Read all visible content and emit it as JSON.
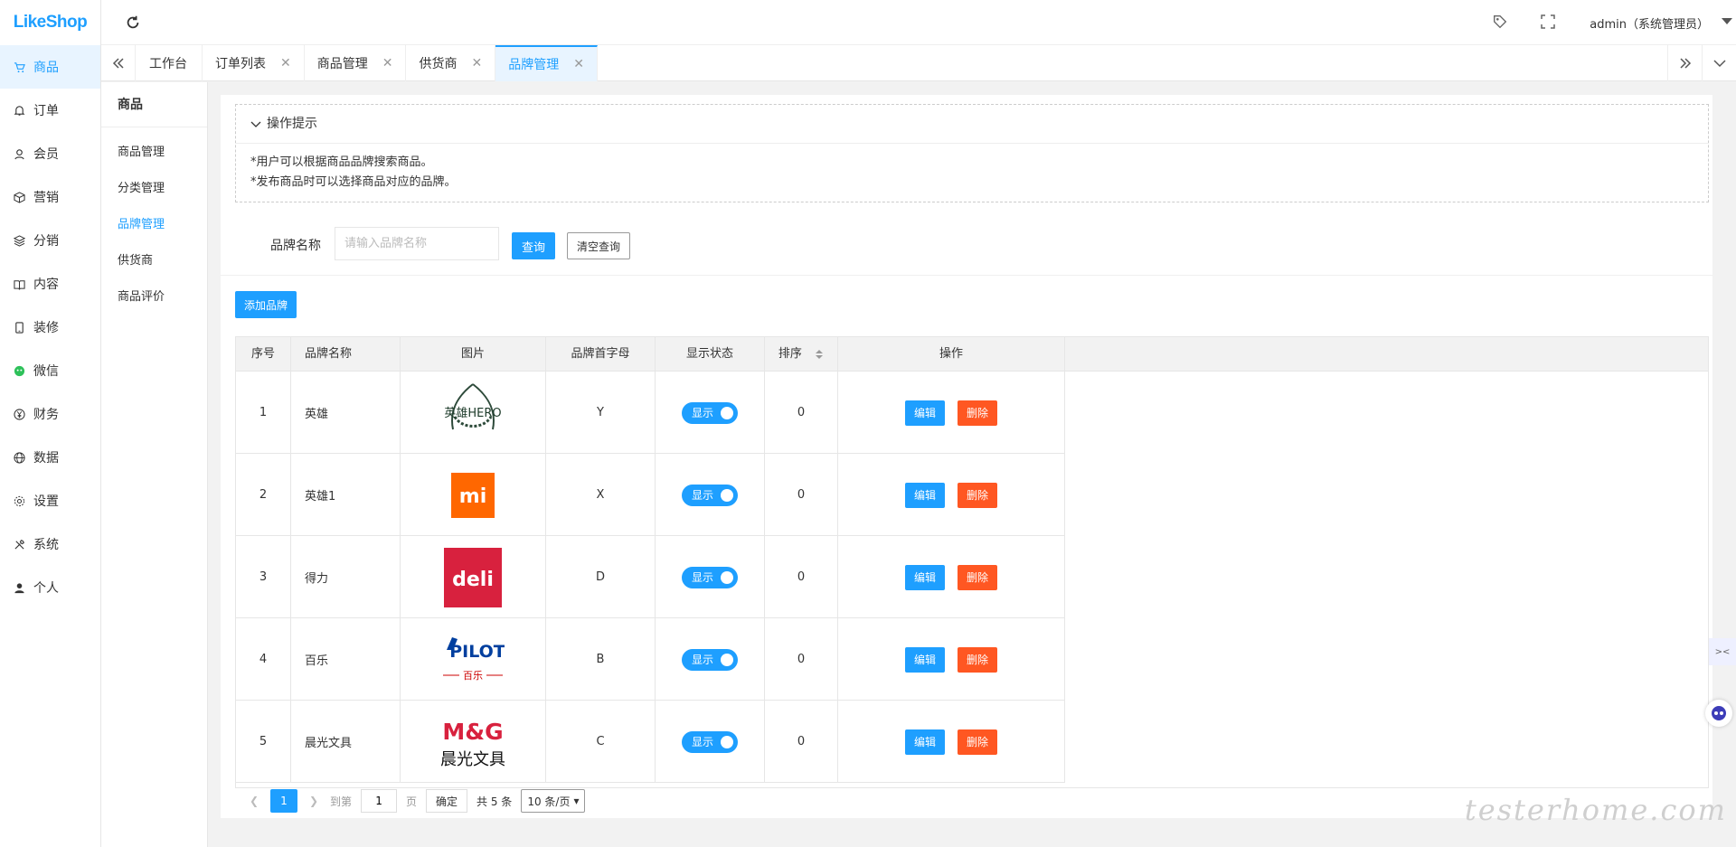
{
  "app": {
    "logo": "LikeShop"
  },
  "sidebar": {
    "items": [
      {
        "label": "商品",
        "icon": "cart-icon",
        "active": true
      },
      {
        "label": "订单",
        "icon": "bell-icon"
      },
      {
        "label": "会员",
        "icon": "user-icon"
      },
      {
        "label": "营销",
        "icon": "cube-icon"
      },
      {
        "label": "分销",
        "icon": "layers-icon"
      },
      {
        "label": "内容",
        "icon": "book-icon"
      },
      {
        "label": "装修",
        "icon": "phone-icon"
      },
      {
        "label": "微信",
        "icon": "wechat-icon"
      },
      {
        "label": "财务",
        "icon": "yen-icon"
      },
      {
        "label": "数据",
        "icon": "globe-icon"
      },
      {
        "label": "设置",
        "icon": "gear-icon"
      },
      {
        "label": "系统",
        "icon": "tools-icon"
      },
      {
        "label": "个人",
        "icon": "person-icon"
      }
    ]
  },
  "header": {
    "user": "admin（系统管理员）"
  },
  "tabs": [
    {
      "label": "工作台",
      "closable": false
    },
    {
      "label": "订单列表",
      "closable": true
    },
    {
      "label": "商品管理",
      "closable": true
    },
    {
      "label": "供货商",
      "closable": true
    },
    {
      "label": "品牌管理",
      "closable": true,
      "active": true
    }
  ],
  "subnav": {
    "title": "商品",
    "items": [
      "商品管理",
      "分类管理",
      "品牌管理",
      "供货商",
      "商品评价"
    ],
    "active_index": 2
  },
  "tips": {
    "title": "操作提示",
    "lines": [
      "*用户可以根据商品品牌搜索商品。",
      "*发布商品时可以选择商品对应的品牌。"
    ]
  },
  "search": {
    "label": "品牌名称",
    "placeholder": "请输入品牌名称",
    "search_btn": "查询",
    "clear_btn": "清空查询"
  },
  "add_btn": "添加品牌",
  "table": {
    "columns": [
      "序号",
      "品牌名称",
      "图片",
      "品牌首字母",
      "显示状态",
      "排序",
      "操作"
    ],
    "rows": [
      {
        "no": "1",
        "name": "英雄",
        "logo": "hero",
        "initial": "Y",
        "status": "显示",
        "sort": "0"
      },
      {
        "no": "2",
        "name": "英雄1",
        "logo": "mi",
        "initial": "X",
        "status": "显示",
        "sort": "0"
      },
      {
        "no": "3",
        "name": "得力",
        "logo": "deli",
        "initial": "D",
        "status": "显示",
        "sort": "0"
      },
      {
        "no": "4",
        "name": "百乐",
        "logo": "pilot",
        "initial": "B",
        "status": "显示",
        "sort": "0"
      },
      {
        "no": "5",
        "name": "晨光文具",
        "logo": "mg",
        "initial": "C",
        "status": "显示",
        "sort": "0"
      }
    ],
    "edit_label": "编辑",
    "delete_label": "删除"
  },
  "logos": {
    "hero_text": "英雄HERO",
    "mi_text": "mi",
    "deli_text": "deli",
    "pilot_text": "PILOT",
    "pilot_sub": "百乐",
    "mg_text": "M&G",
    "mg_sub": "晨光文具"
  },
  "pager": {
    "current": "1",
    "goto_label": "到第",
    "page_value": "1",
    "page_unit": "页",
    "confirm": "确定",
    "total": "共 5 条",
    "page_size": "10 条/页"
  },
  "watermark": "testerhome.com",
  "colors": {
    "primary": "#1e9fff",
    "danger": "#ff5722"
  }
}
